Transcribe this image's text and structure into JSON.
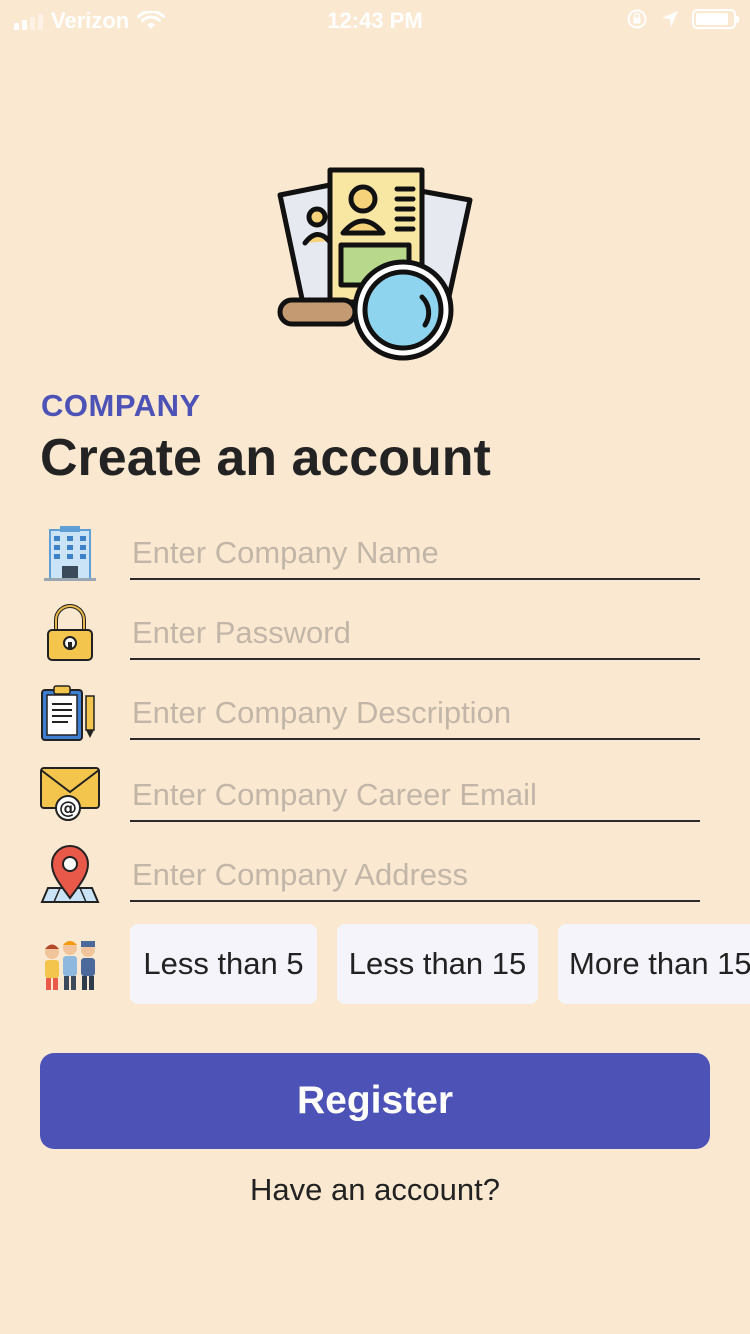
{
  "status_bar": {
    "carrier": "Verizon",
    "time": "12:43 PM"
  },
  "header": {
    "eyebrow": "COMPANY",
    "title": "Create an account"
  },
  "form": {
    "company_name": {
      "placeholder": "Enter Company Name",
      "icon": "office-building-icon"
    },
    "password": {
      "placeholder": "Enter Password",
      "icon": "padlock-icon"
    },
    "description": {
      "placeholder": "Enter Company Description",
      "icon": "clipboard-icon"
    },
    "career_email": {
      "placeholder": "Enter Company Career Email",
      "icon": "email-envelope-icon"
    },
    "address": {
      "placeholder": "Enter Company Address",
      "icon": "map-pin-icon"
    }
  },
  "company_size": {
    "icon": "team-people-icon",
    "options": [
      "Less than 5",
      "Less than 15",
      "More than 15"
    ]
  },
  "actions": {
    "register_label": "Register",
    "have_account_label": "Have an account?"
  },
  "colors": {
    "background": "#fbe8d0",
    "accent": "#4d52b7",
    "chip_bg": "#f5f4fa"
  }
}
